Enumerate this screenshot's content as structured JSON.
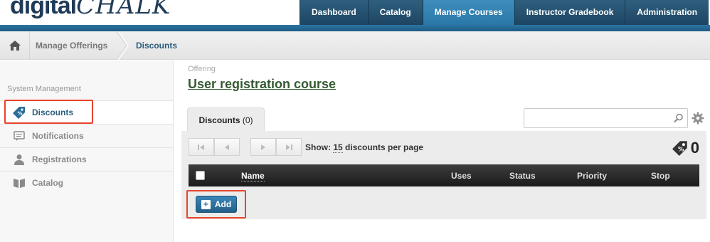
{
  "header": {
    "logo_part1": "digital",
    "logo_part2": "CHALK",
    "nav": [
      {
        "label": "Dashboard"
      },
      {
        "label": "Catalog"
      },
      {
        "label": "Manage Courses"
      },
      {
        "label": "Instructor Gradebook"
      },
      {
        "label": "Administration"
      }
    ],
    "active_nav": "Manage Courses"
  },
  "breadcrumb": {
    "items": [
      "Manage Offerings",
      "Discounts"
    ]
  },
  "sidebar": {
    "title": "System Management",
    "items": [
      {
        "label": "Discounts",
        "icon": "tag-icon"
      },
      {
        "label": "Notifications",
        "icon": "notification-icon"
      },
      {
        "label": "Registrations",
        "icon": "user-icon"
      },
      {
        "label": "Catalog",
        "icon": "book-icon"
      }
    ],
    "active": "Discounts"
  },
  "main": {
    "offering_label": "Offering",
    "offering_title": "User registration course",
    "tab": {
      "label": "Discounts",
      "count": "(0)"
    },
    "search": {
      "value": "",
      "placeholder": ""
    },
    "paging": {
      "show_label": "Show:",
      "per_page": "15",
      "per_page_suffix": "discounts per page"
    },
    "total_count": "0",
    "table": {
      "columns": [
        "Name",
        "Uses",
        "Status",
        "Priority",
        "Stop"
      ]
    },
    "add_label": "Add"
  },
  "colors": {
    "nav_bg": "#1d4563",
    "nav_active": "#2a78a8",
    "highlight": "#e8432c",
    "title_green": "#345a32",
    "link_blue": "#2b5d7c"
  }
}
